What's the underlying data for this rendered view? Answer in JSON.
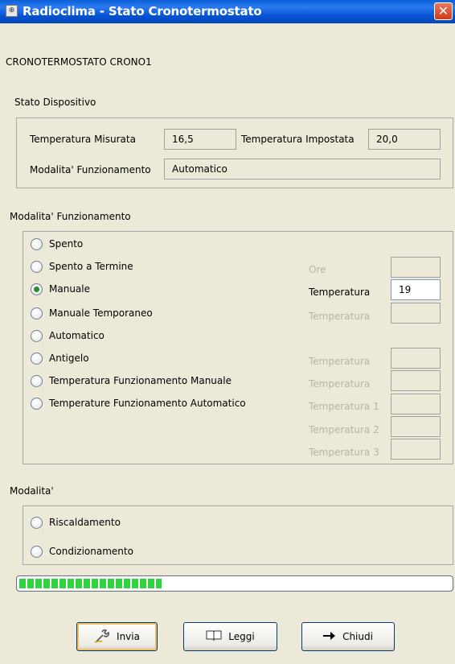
{
  "window": {
    "title": "Radioclima - Stato Cronotermostato",
    "app_icon": "app-icon",
    "close_glyph": "✕"
  },
  "device_name": "CRONOTERMOSTATO CRONO1",
  "stato": {
    "section_label": "Stato Dispositivo",
    "temp_misurata_label": "Temperatura Misurata",
    "temp_misurata_value": "16,5",
    "temp_impostata_label": "Temperatura Impostata",
    "temp_impostata_value": "20,0",
    "modalita_label": "Modalita' Funzionamento",
    "modalita_value": "Automatico"
  },
  "funzionamento": {
    "section_label": "Modalita' Funzionamento",
    "options": [
      {
        "label": "Spento",
        "selected": false
      },
      {
        "label": "Spento a Termine",
        "selected": false
      },
      {
        "label": "Manuale",
        "selected": true
      },
      {
        "label": "Manuale Temporaneo",
        "selected": false
      },
      {
        "label": "Automatico",
        "selected": false
      },
      {
        "label": "Antigelo",
        "selected": false
      },
      {
        "label": "Temperatura Funzionamento Manuale",
        "selected": false
      },
      {
        "label": "Temperature Funzionamento Automatico",
        "selected": false
      }
    ],
    "side_fields": [
      {
        "label": "Ore",
        "value": "",
        "enabled": false
      },
      {
        "label": "Temperatura",
        "value": "19",
        "enabled": true
      },
      {
        "label": "Temperatura",
        "value": "",
        "enabled": false
      },
      {
        "label": "Temperatura",
        "value": "",
        "enabled": false
      },
      {
        "label": "Temperatura",
        "value": "",
        "enabled": false
      },
      {
        "label": "Temperatura 1",
        "value": "",
        "enabled": false
      },
      {
        "label": "Temperatura 2",
        "value": "",
        "enabled": false
      },
      {
        "label": "Temperatura 3",
        "value": "",
        "enabled": false
      }
    ]
  },
  "modalita": {
    "section_label": "Modalita'",
    "options": [
      {
        "label": "Riscaldamento",
        "selected": false
      },
      {
        "label": "Condizionamento",
        "selected": false
      }
    ]
  },
  "progress": {
    "fraction": 0.33,
    "color": "#2fd23f"
  },
  "buttons": {
    "invia_label": "Invia",
    "invia_icon": "wrench-icon",
    "leggi_label": "Leggi",
    "leggi_icon": "book-icon",
    "chiudi_label": "Chiudi",
    "chiudi_icon": "arrow-right-icon"
  }
}
